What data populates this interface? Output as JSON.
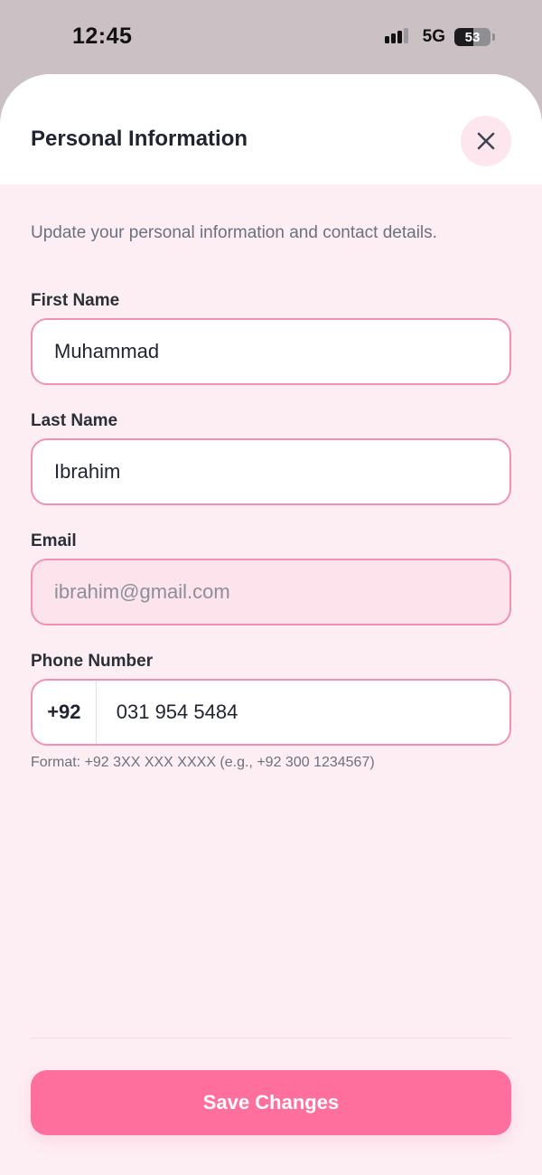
{
  "status_bar": {
    "time": "12:45",
    "network": "5G",
    "battery_percent": "53",
    "signal_icon": "signal-bars-icon",
    "battery_icon": "battery-icon"
  },
  "sheet": {
    "title": "Personal Information",
    "close_icon": "close-icon",
    "subtitle": "Update your personal information and contact details."
  },
  "form": {
    "first_name": {
      "label": "First Name",
      "value": "Muhammad"
    },
    "last_name": {
      "label": "Last Name",
      "value": "Ibrahim"
    },
    "email": {
      "label": "Email",
      "value": "ibrahim@gmail.com",
      "disabled": true
    },
    "phone": {
      "label": "Phone Number",
      "country_code": "+92",
      "value": "031 954 5484",
      "helper": "Format: +92 3XX XXX XXXX (e.g., +92 300 1234567)"
    }
  },
  "footer": {
    "save_label": "Save Changes"
  },
  "colors": {
    "accent": "#ff6f9e",
    "input_border": "#f48fb3",
    "sheet_background": "#fdeef3",
    "disabled_input_background": "#fde3ec"
  }
}
